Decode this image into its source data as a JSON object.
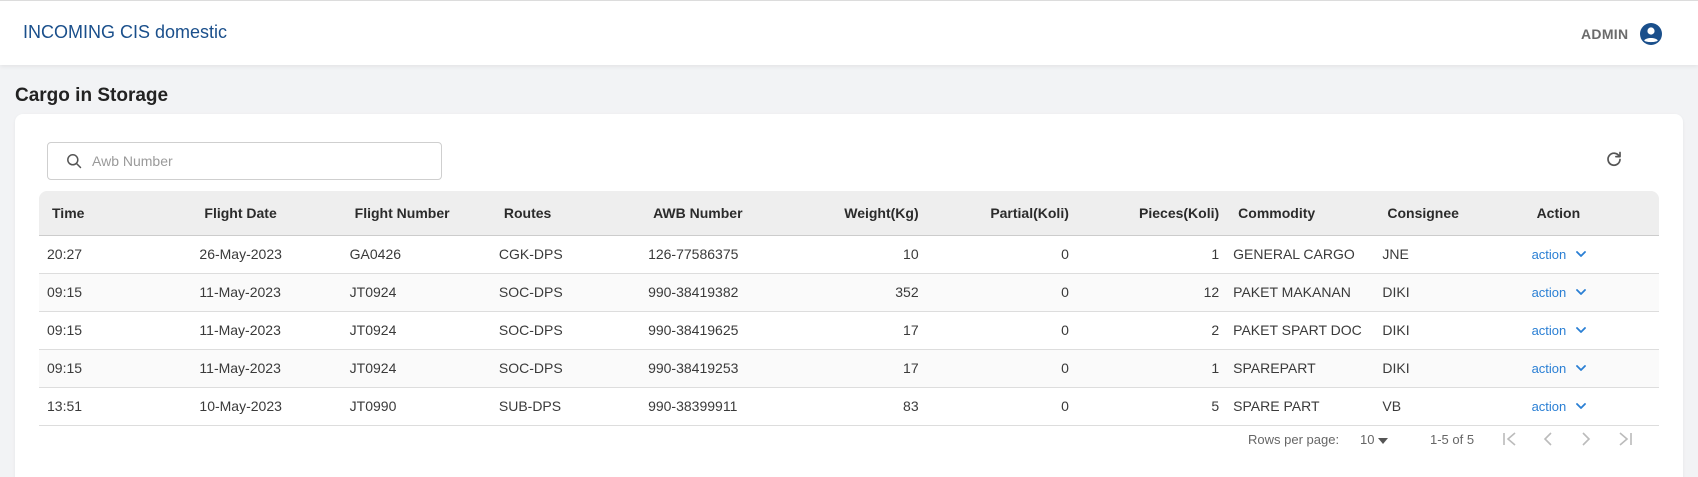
{
  "header": {
    "title": "INCOMING CIS domestic",
    "user_name": "ADMIN"
  },
  "page": {
    "title": "Cargo in Storage"
  },
  "search": {
    "placeholder": "Awb Number",
    "value": ""
  },
  "table": {
    "columns": [
      "Time",
      "Flight Date",
      "Flight Number",
      "Routes",
      "AWB Number",
      "Weight(Kg)",
      "Partial(Koli)",
      "Pieces(Koli)",
      "Commodity",
      "Consignee",
      "Action"
    ],
    "rows": [
      {
        "time": "20:27",
        "flight_date": "26-May-2023",
        "flight_number": "GA0426",
        "route": "CGK-DPS",
        "awb": "126-77586375",
        "weight": "10",
        "partial": "0",
        "pieces": "1",
        "commodity": "GENERAL CARGO",
        "consignee": "JNE",
        "action": "action"
      },
      {
        "time": "09:15",
        "flight_date": "11-May-2023",
        "flight_number": "JT0924",
        "route": "SOC-DPS",
        "awb": "990-38419382",
        "weight": "352",
        "partial": "0",
        "pieces": "12",
        "commodity": "PAKET MAKANAN",
        "consignee": "DIKI",
        "action": "action"
      },
      {
        "time": "09:15",
        "flight_date": "11-May-2023",
        "flight_number": "JT0924",
        "route": "SOC-DPS",
        "awb": "990-38419625",
        "weight": "17",
        "partial": "0",
        "pieces": "2",
        "commodity": "PAKET SPART DOC",
        "consignee": "DIKI",
        "action": "action"
      },
      {
        "time": "09:15",
        "flight_date": "11-May-2023",
        "flight_number": "JT0924",
        "route": "SOC-DPS",
        "awb": "990-38419253",
        "weight": "17",
        "partial": "0",
        "pieces": "1",
        "commodity": "SPAREPART",
        "consignee": "DIKI",
        "action": "action"
      },
      {
        "time": "13:51",
        "flight_date": "10-May-2023",
        "flight_number": "JT0990",
        "route": "SUB-DPS",
        "awb": "990-38399911",
        "weight": "83",
        "partial": "0",
        "pieces": "5",
        "commodity": "SPARE PART",
        "consignee": "VB",
        "action": "action"
      }
    ]
  },
  "pagination": {
    "rows_per_page_label": "Rows per page:",
    "rows_per_page": "10",
    "range": "1-5 of 5"
  },
  "colors": {
    "brand": "#1a4f8b",
    "link": "#2a7fd4",
    "header_row": "#eeeeee",
    "background": "#f2f3f5"
  },
  "icons": {
    "user": "account-circle-icon",
    "search": "search-icon",
    "refresh": "refresh-icon",
    "action": "chevron-down-icon",
    "pager": [
      "first-page-icon",
      "prev-page-icon",
      "next-page-icon",
      "last-page-icon"
    ]
  }
}
